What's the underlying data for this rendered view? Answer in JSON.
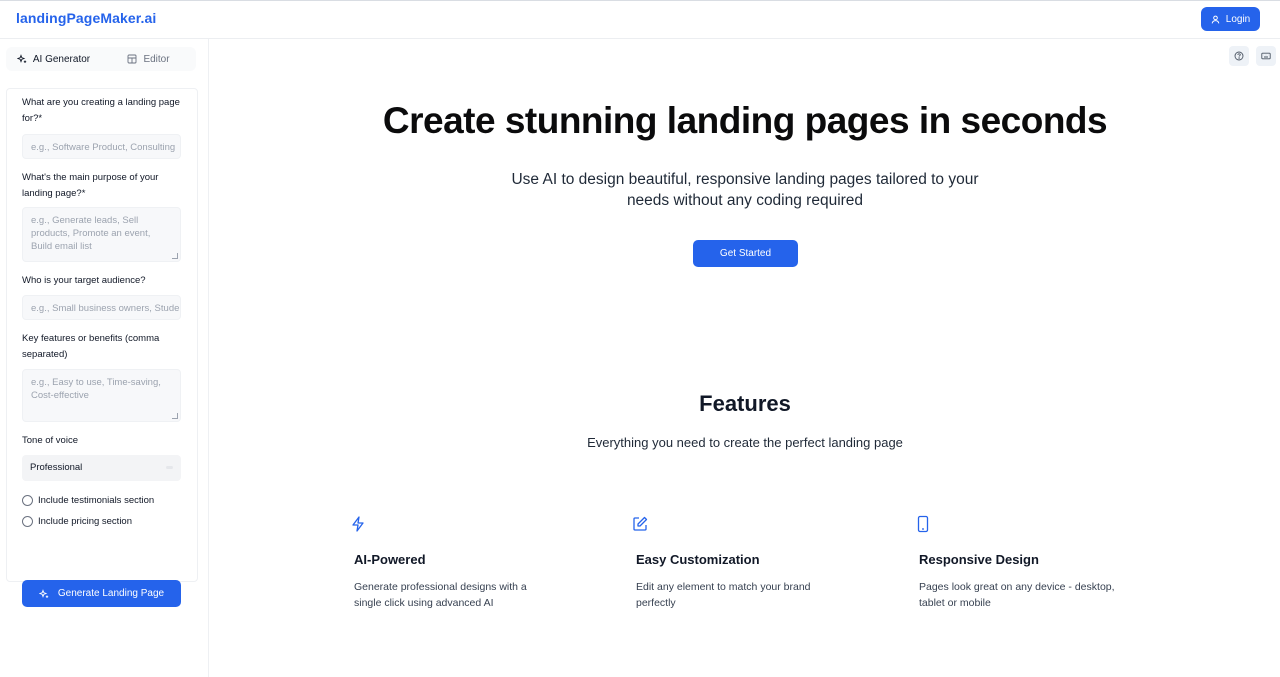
{
  "header": {
    "logo": "landingPageMaker.ai",
    "login_label": "Login"
  },
  "sidebar": {
    "tabs": [
      {
        "label": "AI Generator",
        "icon": "sparkles-icon"
      },
      {
        "label": "Editor",
        "icon": "layout-icon"
      }
    ],
    "form": {
      "q1_label": "What are you creating a landing page for?*",
      "q1_placeholder": "e.g., Software Product, Consulting",
      "q2_label": "What's the main purpose of your landing page?*",
      "q2_placeholder": "e.g., Generate leads, Sell products, Promote an event, Build email list",
      "q3_label": "Who is your target audience?",
      "q3_placeholder": "e.g., Small business owners, Students",
      "q4_label": "Key features or benefits (comma separated)",
      "q4_placeholder": "e.g., Easy to use, Time-saving, Cost-effective",
      "tone_label": "Tone of voice",
      "tone_value": "Professional",
      "testimonials_label": "Include testimonials section",
      "pricing_label": "Include pricing section",
      "generate_label": "Generate Landing Page"
    }
  },
  "hero": {
    "title": "Create stunning landing pages in seconds",
    "subtitle": "Use AI to design beautiful, responsive landing pages tailored to your needs without any coding required",
    "cta_label": "Get Started"
  },
  "features": {
    "title": "Features",
    "subtitle": "Everything you need to create the perfect landing page",
    "items": [
      {
        "title": "AI-Powered",
        "desc": "Generate professional designs with a single click using advanced AI",
        "icon": "lightning-icon"
      },
      {
        "title": "Easy Customization",
        "desc": "Edit any element to match your brand perfectly",
        "icon": "edit-icon"
      },
      {
        "title": "Responsive Design",
        "desc": "Pages look great on any device - desktop, tablet or mobile",
        "icon": "mobile-icon"
      }
    ]
  },
  "colors": {
    "accent": "#2563eb"
  }
}
